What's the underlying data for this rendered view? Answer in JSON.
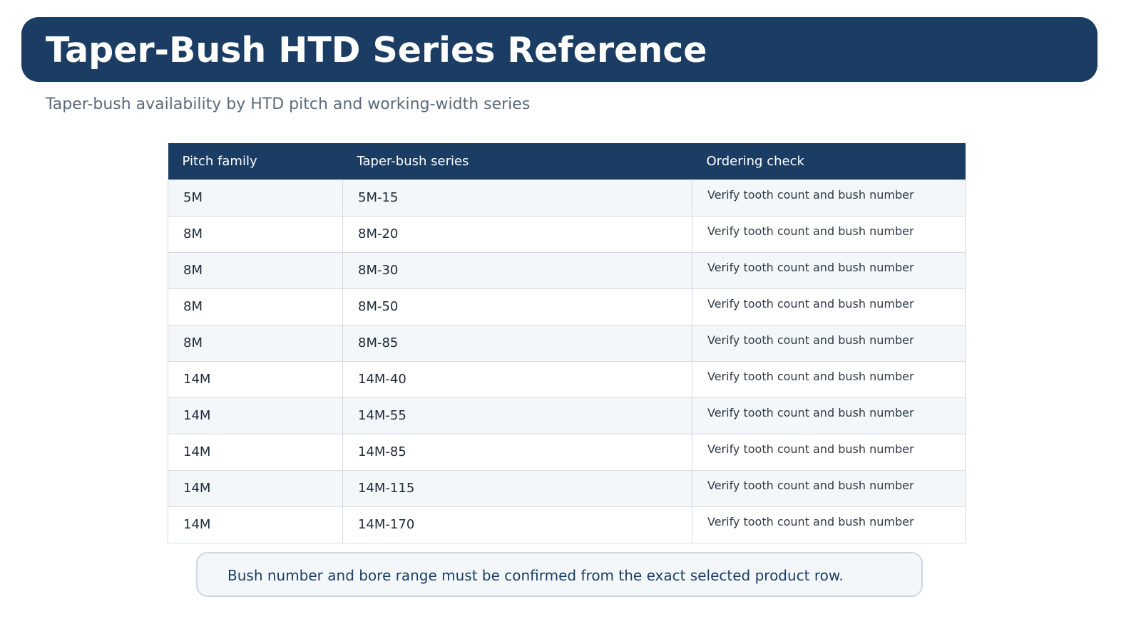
{
  "header": {
    "title": "Taper-Bush HTD Series Reference",
    "subtitle": "Taper-bush availability by HTD pitch and working-width series"
  },
  "table": {
    "columns": [
      "Pitch family",
      "Taper-bush series",
      "Ordering check"
    ],
    "rows": [
      {
        "pitch": "5M",
        "series": "5M-15",
        "check": "Verify tooth count and bush number"
      },
      {
        "pitch": "8M",
        "series": "8M-20",
        "check": "Verify tooth count and bush number"
      },
      {
        "pitch": "8M",
        "series": "8M-30",
        "check": "Verify tooth count and bush number"
      },
      {
        "pitch": "8M",
        "series": "8M-50",
        "check": "Verify tooth count and bush number"
      },
      {
        "pitch": "8M",
        "series": "8M-85",
        "check": "Verify tooth count and bush number"
      },
      {
        "pitch": "14M",
        "series": "14M-40",
        "check": "Verify tooth count and bush number"
      },
      {
        "pitch": "14M",
        "series": "14M-55",
        "check": "Verify tooth count and bush number"
      },
      {
        "pitch": "14M",
        "series": "14M-85",
        "check": "Verify tooth count and bush number"
      },
      {
        "pitch": "14M",
        "series": "14M-115",
        "check": "Verify tooth count and bush number"
      },
      {
        "pitch": "14M",
        "series": "14M-170",
        "check": "Verify tooth count and bush number"
      }
    ]
  },
  "note": {
    "text": "Bush number and bore range must be confirmed from the exact selected product row."
  },
  "colors": {
    "header_bg": "#1c3d63",
    "row_alt_bg": "#f3f7fa",
    "border": "#d2dae2",
    "subtitle_text": "#5b6b7b"
  }
}
